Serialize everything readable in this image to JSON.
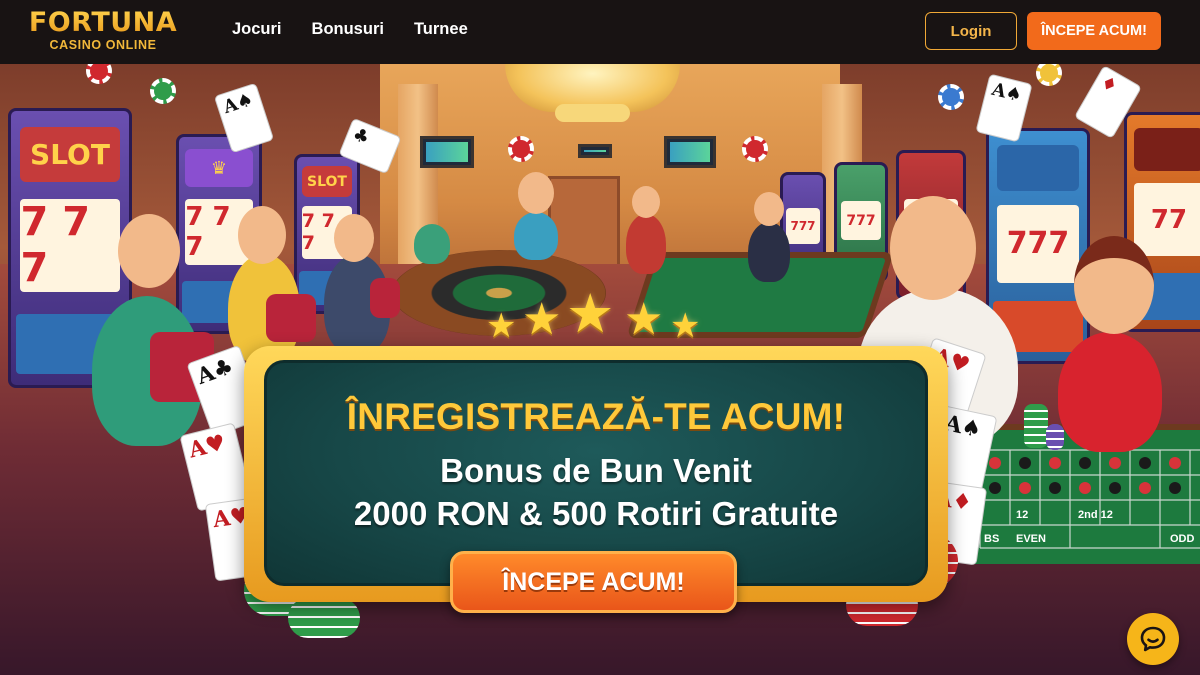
{
  "brand": {
    "name": "FORTUNA",
    "tagline": "CASINO ONLINE"
  },
  "nav": {
    "items": [
      {
        "label": "Jocuri"
      },
      {
        "label": "Bonusuri"
      },
      {
        "label": "Turnee"
      }
    ]
  },
  "header": {
    "login_label": "Login",
    "start_label": "ÎNCEPE ACUM!"
  },
  "hero": {
    "scene_signs": [
      "SLOT",
      "SLOT"
    ],
    "slot_reels": [
      "7 7 7",
      "7 7 7",
      "7 7 7"
    ],
    "table_labels": [
      "BS",
      "EVEN",
      "12",
      "2nd 12",
      "ODD"
    ]
  },
  "promo": {
    "headline": "ÎNREGISTREAZĂ-TE ACUM!",
    "line1": "Bonus de Bun Venit",
    "line2": "2000 RON & 500 Rotiri Gratuite",
    "cta_label": "ÎNCEPE ACUM!"
  },
  "icons": {
    "chat": "chat-bubble-icon"
  },
  "colors": {
    "accent_gold": "#f5b21a",
    "cta_orange": "#f26a1b",
    "banner_teal": "#174848"
  }
}
